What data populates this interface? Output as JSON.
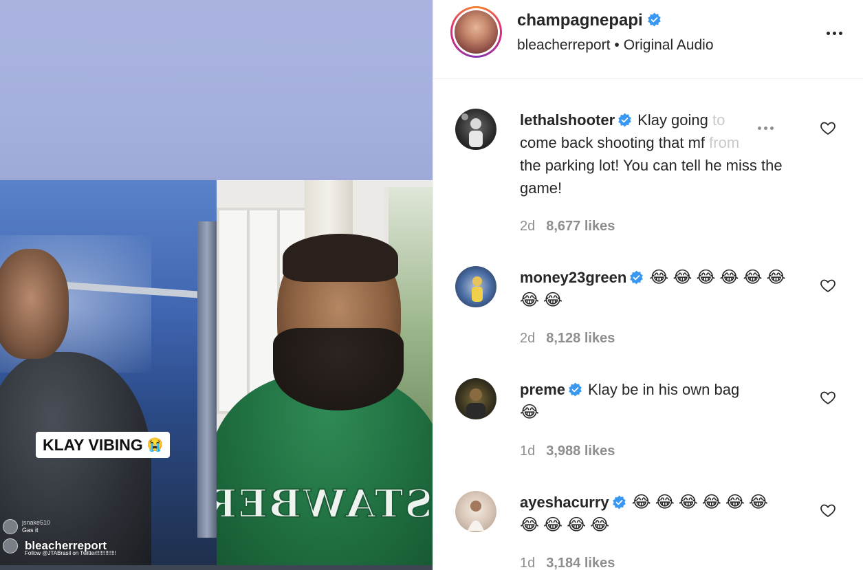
{
  "post": {
    "username": "champagnepapi",
    "subtitle_account": "bleacherreport",
    "subtitle_separator": "•",
    "subtitle_audio": "Original Audio"
  },
  "media": {
    "overlay_caption": "KLAY VIBING",
    "overlay_emoji": "😭",
    "hoodie_text": "STAWBERS",
    "live_comments": [
      {
        "user": "jsnake510",
        "text": "Gas it"
      },
      {
        "user": "",
        "text": "Follow @JTABrasil on Twitter!!!!!!!!!!!!!"
      }
    ],
    "watermark": "bleacherreport"
  },
  "comments": [
    {
      "username": "lethalshooter",
      "text_main": "Klay going ",
      "text_fade1": "to",
      "text_line2": "come back shooting that mf ",
      "text_fade2": "from",
      "text_rest": "the parking lot! You can tell he miss the game!",
      "age": "2d",
      "likes": "8,677 likes"
    },
    {
      "username": "money23green",
      "text": "😂😂😂😂😂😂😂😂",
      "age": "2d",
      "likes": "8,128 likes"
    },
    {
      "username": "preme",
      "text": "Klay be in his own bag",
      "text_emoji": "😂",
      "age": "1d",
      "likes": "3,988 likes"
    },
    {
      "username": "ayeshacurry",
      "text": "😂😂😂😂😂😂😂😂😂😂",
      "age": "1d",
      "likes": "3,184 likes"
    }
  ],
  "colors": {
    "verified_blue": "#3897f0",
    "text_primary": "#262626",
    "text_secondary": "#8e8e8e"
  }
}
